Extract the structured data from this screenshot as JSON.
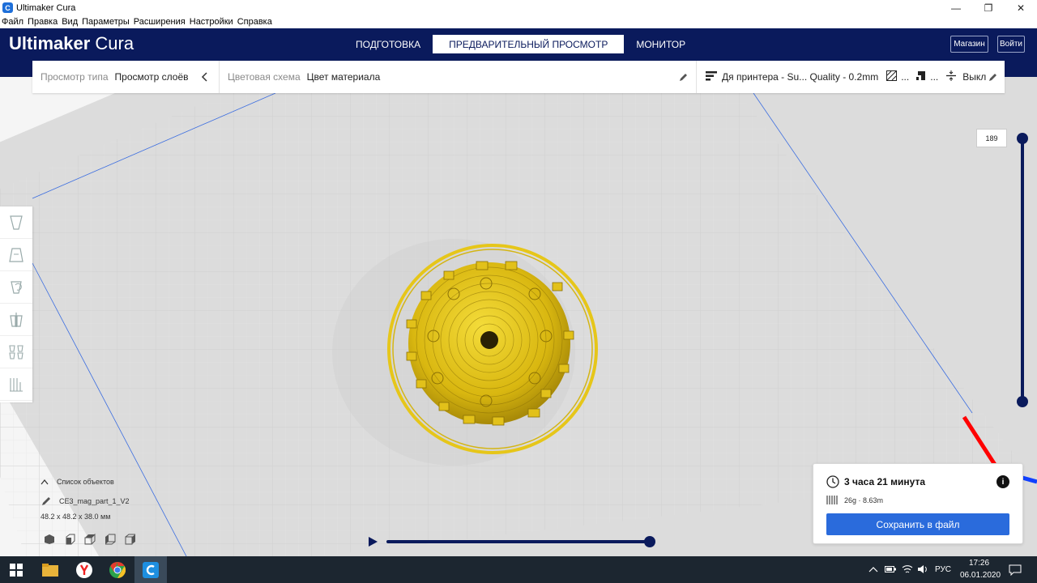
{
  "window": {
    "title": "Ultimaker Cura",
    "app_icon_glyph": "C",
    "minimize": "—",
    "maximize": "❐",
    "close": "✕"
  },
  "menu": [
    "Файл",
    "Правка",
    "Вид",
    "Параметры",
    "Расширения",
    "Настройки",
    "Справка"
  ],
  "header": {
    "brand_bold": "Ultimaker",
    "brand_light": "Cura",
    "tabs": [
      "ПОДГОТОВКА",
      "ПРЕДВАРИТЕЛЬНЫЙ ПРОСМОТР",
      "МОНИТОР"
    ],
    "active_tab": 1,
    "store_label": "Магазин",
    "login_label": "Войти"
  },
  "toolbar": {
    "view_type_label": "Просмотр типа",
    "view_type_value": "Просмотр слоёв",
    "color_scheme_label": "Цветовая схема",
    "color_scheme_value": "Цвет материала",
    "printer_profile": "Дя принтера - Su... Quality - 0.2mm",
    "support_ellipsis": "...",
    "adhesion_ellipsis": "...",
    "adhesion_value": "Выкл"
  },
  "objects": {
    "header": "Список объектов",
    "item_name": "CE3_mag_part_1_V2",
    "dimensions": "48.2 x 48.2 x 38.0 мм"
  },
  "layer_slider": {
    "value": "189"
  },
  "print_info": {
    "time": "3 часа 21 минута",
    "material": "26g · 8.63m",
    "info_glyph": "i",
    "save_label": "Сохранить в файл"
  },
  "taskbar": {
    "lang": "РУС",
    "time": "17:26",
    "date": "06.01.2020"
  },
  "colors": {
    "header_bg": "#0a1a5c",
    "accent_button": "#2a6bdc",
    "model_yellow": "#e6c619",
    "x_axis": "#ff0000",
    "z_axis": "#1040ff"
  },
  "icons": {
    "collapse": "chevron-left-icon",
    "edit": "pencil-icon",
    "clock": "clock-icon",
    "info": "info-icon",
    "spool": "filament-icon",
    "play": "play-icon"
  }
}
